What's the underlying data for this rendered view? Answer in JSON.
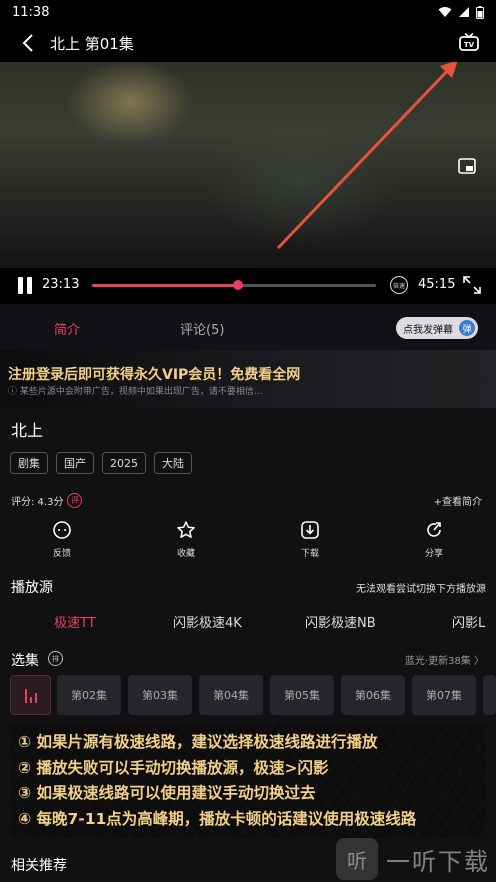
{
  "status_bar": {
    "time": "11:38"
  },
  "header": {
    "title": "北上  第01集"
  },
  "player": {
    "current_time": "23:13",
    "total_time": "45:15",
    "progress": 0.513,
    "speed_label": "倍速"
  },
  "tabs": {
    "intro": "简介",
    "comments": "评论(5)",
    "danmu_button": "点我发弹幕",
    "danmu_toggle": "弹"
  },
  "promo": {
    "title": "注册登录后即可获得永久VIP会员！免费看全网",
    "note": "ⓘ 某些片源中会附带广告，视频中如果出现广告，请不要相信..."
  },
  "show": {
    "title": "北上",
    "tags": [
      "剧集",
      "国产",
      "2025",
      "大陆"
    ],
    "rating": "评分: 4.3分",
    "rate_icon": "评",
    "view_intro": "+查看简介"
  },
  "actions": [
    {
      "label": "反馈",
      "icon": "feedback-icon"
    },
    {
      "label": "收藏",
      "icon": "star-icon"
    },
    {
      "label": "下载",
      "icon": "download-icon"
    },
    {
      "label": "分享",
      "icon": "share-icon"
    }
  ],
  "sources": {
    "heading": "播放源",
    "hint": "无法观看尝试切换下方播放源",
    "items": [
      "极速TT",
      "闪影极速4K",
      "闪影极速NB",
      "闪影L"
    ]
  },
  "episodes": {
    "heading": "选集",
    "sort_icon": "排",
    "update_info": "蓝光·更新38集 〉",
    "items": [
      "第02集",
      "第03集",
      "第04集",
      "第05集",
      "第06集",
      "第07集"
    ]
  },
  "notice": {
    "lines": [
      "① 如果片源有极速线路，建议选择极速线路进行播放",
      "② 播放失败可以手动切换播放源，极速>闪影",
      "③ 如果极速线路可以使用建议手动切换过去",
      "④ 每晚7-11点为高峰期，播放卡顿的话建议使用极速线路"
    ]
  },
  "related": {
    "heading": "相关推荐"
  },
  "watermark": {
    "icon_text": "听",
    "text": "一听下载"
  },
  "colors": {
    "accent": "#e8415f",
    "gold": "#f2d089",
    "annotation": "#e5533d"
  }
}
